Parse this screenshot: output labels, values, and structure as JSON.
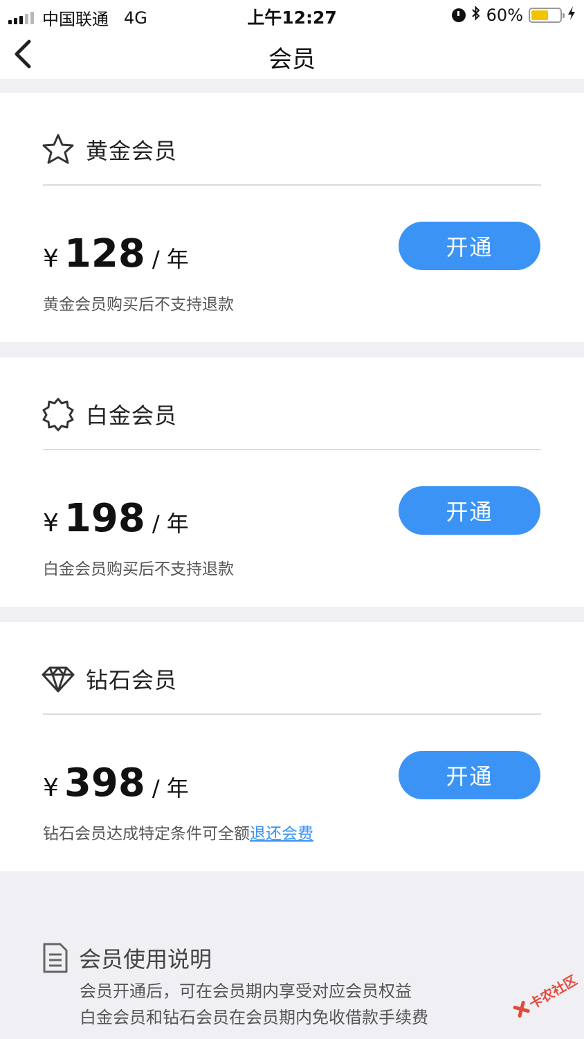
{
  "status_bar": {
    "carrier": "中国联通",
    "network": "4G",
    "time": "上午12:27",
    "battery_percent": "60%",
    "battery_level": 0.6,
    "battery_color": "#f5c400",
    "icons": [
      "signal-icon",
      "alarm-icon",
      "bluetooth-icon",
      "battery-icon",
      "charging-icon"
    ]
  },
  "nav": {
    "title": "会员",
    "back_icon": "chevron-left-icon"
  },
  "plans": [
    {
      "icon": "star-icon",
      "name": "黄金会员",
      "currency": "¥",
      "price": "128",
      "unit": "/ 年",
      "button": "开通",
      "note": "黄金会员购买后不支持退款"
    },
    {
      "icon": "badge-icon",
      "name": "白金会员",
      "currency": "¥",
      "price": "198",
      "unit": "/ 年",
      "button": "开通",
      "note": "白金会员购买后不支持退款"
    },
    {
      "icon": "diamond-icon",
      "name": "钻石会员",
      "currency": "¥",
      "price": "398",
      "unit": "/ 年",
      "button": "开通",
      "note": "钻石会员达成特定条件可全额",
      "note_link": "退还会费"
    }
  ],
  "instructions": {
    "icon": "document-icon",
    "title": "会员使用说明",
    "lines": [
      "会员开通后，可在会员期内享受对应会员权益",
      "白金会员和钻石会员在会员期内免收借款手续费"
    ]
  },
  "watermark": {
    "text": "卡农社区"
  },
  "colors": {
    "accent": "#3b94f5",
    "background": "#efeff4"
  }
}
